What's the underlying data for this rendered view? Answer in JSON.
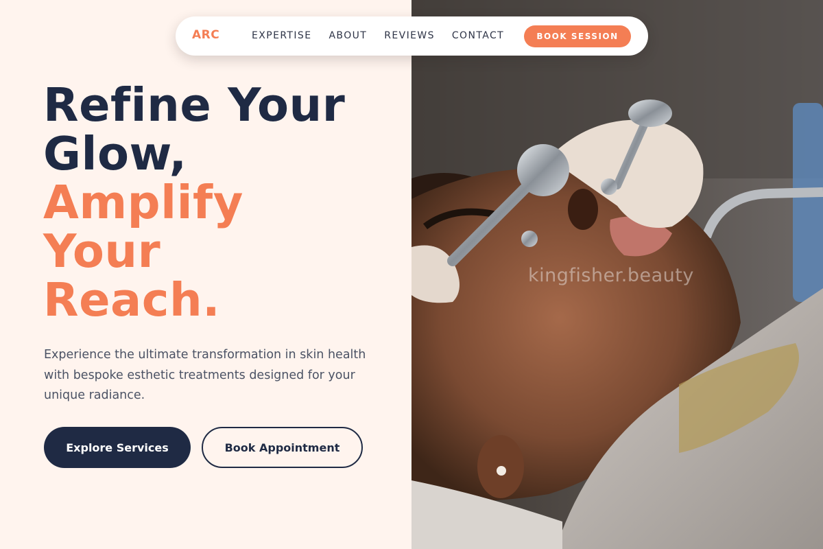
{
  "nav": {
    "logo": "ARC",
    "links": [
      "EXPERTISE",
      "ABOUT",
      "REVIEWS",
      "CONTACT"
    ],
    "cta": "BOOK SESSION"
  },
  "hero": {
    "title_line1": "Refine Your",
    "title_line2": "Glow,",
    "title_line3": "Amplify",
    "title_line4": "Your",
    "title_line5": "Reach.",
    "description": "Experience the ultimate transformation in skin health with bespoke esthetic treatments designed for your unique radiance.",
    "primary_button": "Explore Services",
    "secondary_button": "Book Appointment"
  },
  "image": {
    "watermark": "kingfisher.beauty",
    "subject": "facial treatment with steel globe tools"
  },
  "colors": {
    "background": "#fff4ee",
    "navy": "#1f2a44",
    "accent": "#f47e54",
    "body_text": "#4a5264"
  }
}
